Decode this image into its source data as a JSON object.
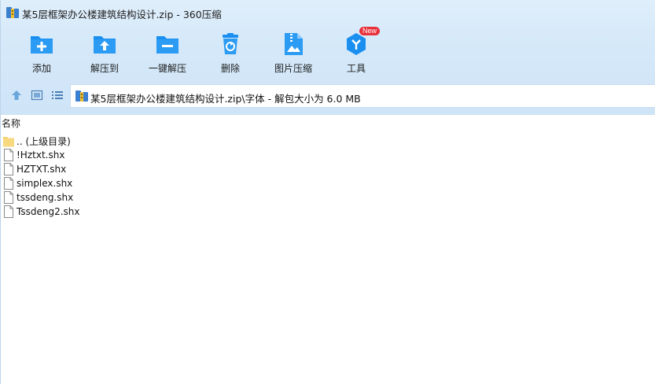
{
  "window": {
    "title": "某5层框架办公楼建筑结构设计.zip - 360压缩"
  },
  "toolbar": {
    "items": [
      {
        "label": "添加",
        "icon": "add-folder-icon"
      },
      {
        "label": "解压到",
        "icon": "extract-to-icon"
      },
      {
        "label": "一键解压",
        "icon": "one-click-extract-icon"
      },
      {
        "label": "删除",
        "icon": "trash-icon"
      },
      {
        "label": "图片压缩",
        "icon": "image-compress-icon"
      },
      {
        "label": "工具",
        "icon": "tools-icon",
        "badge": "New"
      }
    ]
  },
  "address": {
    "path": "某5层框架办公楼建筑结构设计.zip\\字体 - 解包大小为 6.0 MB"
  },
  "list": {
    "column_name": "名称",
    "rows": [
      {
        "name": ".. (上级目录)",
        "type": "folder"
      },
      {
        "name": "!Hztxt.shx",
        "type": "file"
      },
      {
        "name": "HZTXT.shx",
        "type": "file"
      },
      {
        "name": "simplex.shx",
        "type": "file"
      },
      {
        "name": "tssdeng.shx",
        "type": "file"
      },
      {
        "name": "Tssdeng2.shx",
        "type": "file"
      }
    ]
  },
  "colors": {
    "accent": "#1a8ff0",
    "toolbar_bg": "#d6e9f9",
    "badge": "#e8323c"
  }
}
